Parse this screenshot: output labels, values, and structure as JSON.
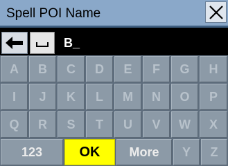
{
  "title": "Spell POI Name",
  "entry": {
    "text": "B_"
  },
  "keyboard": {
    "rows": [
      [
        "A",
        "B",
        "C",
        "D",
        "E",
        "F",
        "G",
        "H"
      ],
      [
        "I",
        "J",
        "K",
        "L",
        "M",
        "N",
        "O",
        "P"
      ],
      [
        "Q",
        "R",
        "S",
        "T",
        "U",
        "V",
        "W",
        "X"
      ]
    ],
    "bottom": {
      "numbers": "123",
      "ok": "OK",
      "more": "More",
      "y": "Y",
      "z": "Z"
    }
  },
  "colors": {
    "title_bar": "#8aa8c9",
    "ok_key": "#ffff00",
    "keyboard_bg": "#5e6d7d"
  }
}
